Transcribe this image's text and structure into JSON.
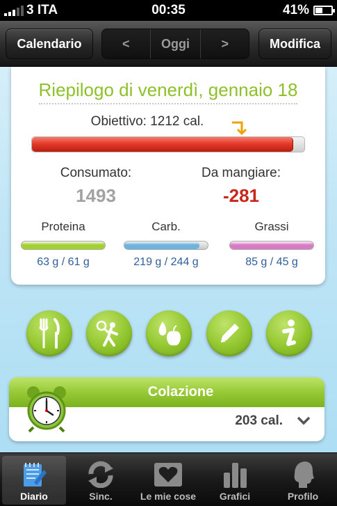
{
  "status_bar": {
    "carrier": "3 ITA",
    "time": "00:35",
    "battery": "41%"
  },
  "nav": {
    "left_button": "Calendario",
    "prev": "<",
    "today": "Oggi",
    "next": ">",
    "right_button": "Modifica"
  },
  "summary": {
    "title": "Riepilogo di venerdì, gennaio 18",
    "goal_label": "Obiettivo: 1212 cal.",
    "calorie_progress": 0.96,
    "consumed_label": "Consumato:",
    "consumed_value": "1493",
    "remaining_label": "Da mangiare:",
    "remaining_value": "-281"
  },
  "macros": [
    {
      "name": "Proteina",
      "value": "63 g / 61 g",
      "progress": 1.0,
      "color": "#a4d12f"
    },
    {
      "name": "Carb.",
      "value": "219 g / 244 g",
      "progress": 0.9,
      "color": "#6cb3dd"
    },
    {
      "name": "Grassi",
      "value": "85 g / 45 g",
      "progress": 1.0,
      "color": "#d97bc4"
    }
  ],
  "actions": [
    {
      "icon": "fork-knife-icon"
    },
    {
      "icon": "exercise-icon"
    },
    {
      "icon": "water-apple-icon"
    },
    {
      "icon": "pencil-icon"
    },
    {
      "icon": "info-icon"
    }
  ],
  "meal": {
    "name": "Colazione",
    "calories": "203 cal.",
    "icon": "alarm-clock-icon"
  },
  "tabs": [
    {
      "label": "Diario",
      "icon": "diary-icon",
      "active": true
    },
    {
      "label": "Sinc.",
      "icon": "sync-icon",
      "active": false
    },
    {
      "label": "Le mie cose",
      "icon": "heart-box-icon",
      "active": false
    },
    {
      "label": "Grafici",
      "icon": "chart-icon",
      "active": false
    },
    {
      "label": "Profilo",
      "icon": "profile-icon",
      "active": false
    }
  ],
  "colors": {
    "accent_green": "#8ec02a",
    "over_red": "#c9271a",
    "macro_value_blue": "#2f5d9a"
  }
}
